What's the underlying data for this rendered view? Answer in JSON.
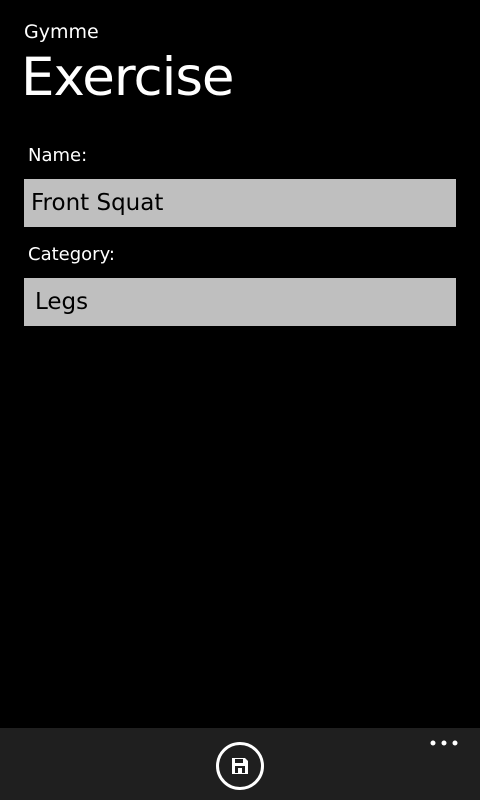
{
  "app": {
    "name": "Gymme",
    "page_title": "Exercise"
  },
  "form": {
    "name_label": "Name:",
    "name_value": "Front Squat",
    "category_label": "Category:",
    "category_value": "Legs"
  },
  "app_bar": {
    "save_icon": "save-icon",
    "more_icon": "ellipsis-icon"
  },
  "colors": {
    "background": "#000000",
    "text": "#ffffff",
    "field_background": "#bfbfbf",
    "field_text": "#000000",
    "app_bar_background": "#1f1f1f"
  }
}
